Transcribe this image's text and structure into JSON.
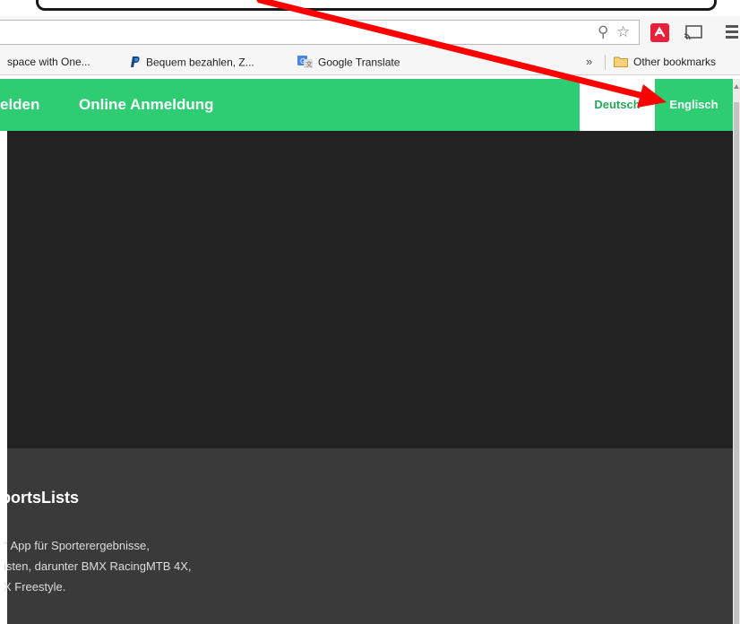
{
  "browser": {
    "bookmarks": [
      {
        "label": "space with One..."
      },
      {
        "label": "Bequem bezahlen, Z..."
      },
      {
        "label": "Google Translate"
      }
    ],
    "overflow_chevron": "»",
    "other_bookmarks": "Other bookmarks"
  },
  "site": {
    "nav": {
      "item_1": "elden",
      "item_2": "Online Anmeldung"
    },
    "languages": {
      "de": "Deutsch",
      "en": "Englisch"
    },
    "info": {
      "title": "portsLists",
      "line_1": "\" App für Sporterergebnisse,",
      "line_2": "isten, darunter BMX RacingMTB 4X,",
      "line_3": "X Freestyle."
    }
  },
  "colors": {
    "nav_green": "#2ecd73",
    "hero_dark": "#222222",
    "info_dark": "#3a3a3a",
    "annotation_red": "#ff0000"
  }
}
